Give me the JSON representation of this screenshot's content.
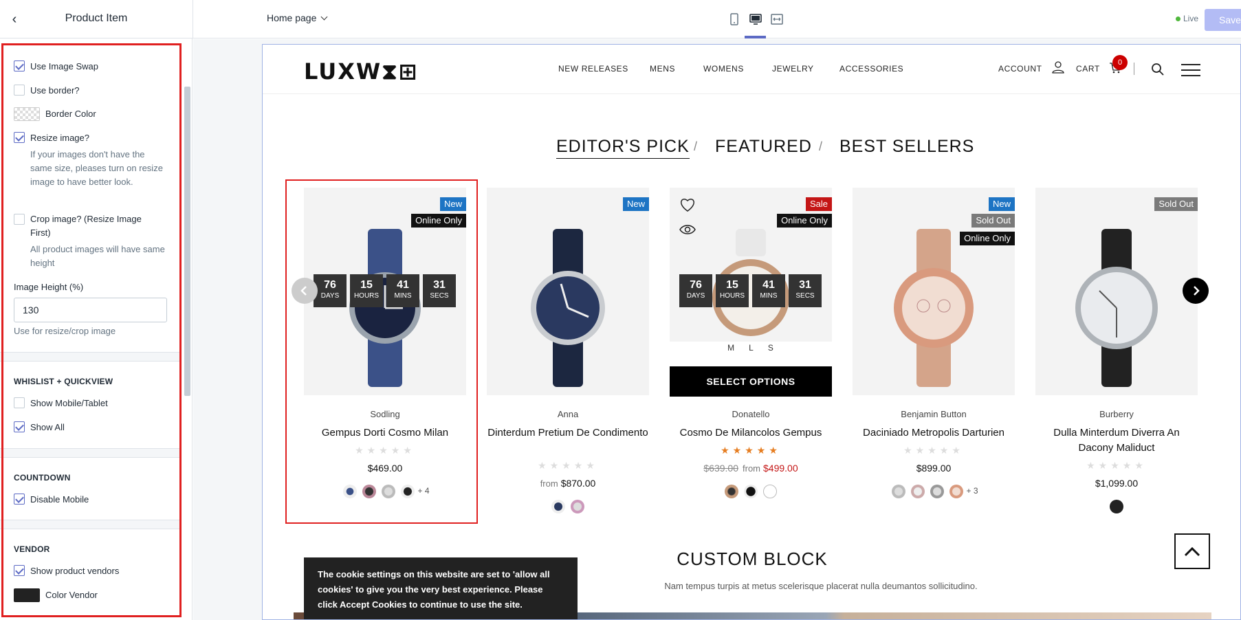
{
  "editor": {
    "panel_title": "Product Item",
    "page_selector": "Home page",
    "live_label": "Live",
    "save_label": "Save"
  },
  "sidebar": {
    "use_image_swap": {
      "label": "Use Image Swap",
      "checked": true
    },
    "use_border": {
      "label": "Use border?",
      "checked": false
    },
    "border_color": {
      "label": "Border Color"
    },
    "resize_image": {
      "label": "Resize image?",
      "checked": true,
      "help": "If your images don't have the same size, pleases turn on resize image to have better look."
    },
    "crop_image": {
      "label": "Crop image? (Resize Image First)",
      "checked": false,
      "help": "All product images will have same height"
    },
    "image_height": {
      "label": "Image Height (%)",
      "value": "130",
      "help": "Use for resize/crop image"
    },
    "wishlist_section": {
      "heading": "WHISLIST + QUICKVIEW",
      "show_mobile": {
        "label": "Show Mobile/Tablet",
        "checked": false
      },
      "show_all": {
        "label": "Show All",
        "checked": true
      }
    },
    "countdown_section": {
      "heading": "COUNTDOWN",
      "disable_mobile": {
        "label": "Disable Mobile",
        "checked": true
      }
    },
    "vendor_section": {
      "heading": "VENDOR",
      "show_vendors": {
        "label": "Show product vendors",
        "checked": true
      },
      "color_vendor": {
        "label": "Color Vendor",
        "color": "#222222"
      }
    }
  },
  "store": {
    "logo": "LUXW⧗⊞",
    "nav": [
      "NEW RELEASES",
      "MENS",
      "WOMENS",
      "JEWELRY",
      "ACCESSORIES"
    ],
    "account_label": "ACCOUNT",
    "cart_label": "CART",
    "cart_count": "0",
    "tabs": [
      "EDITOR'S PICK",
      "FEATURED",
      "BEST SELLERS"
    ],
    "tab_sep": "/",
    "products": [
      {
        "vendor": "Sodling",
        "name": "Gempus Dorti Cosmo Milan",
        "badges": [
          "New",
          "Online Only"
        ],
        "price": "$469.00",
        "more": "+ 4",
        "rating": 0,
        "countdown": {
          "days": "76",
          "days_label": "DAYS",
          "hours": "15",
          "hours_label": "HOURS",
          "mins": "41",
          "mins_label": "MINS",
          "secs": "31",
          "secs_label": "SECS"
        }
      },
      {
        "vendor": "Anna",
        "name": "Dinterdum Pretium De Condimento",
        "badges": [
          "New"
        ],
        "from": "from",
        "price": "$870.00",
        "rating": 0
      },
      {
        "vendor": "Donatello",
        "name": "Cosmo De Milancolos Gempus",
        "badges": [
          "Sale",
          "Online Only"
        ],
        "old_price": "$639.00",
        "from": "from",
        "price": "$499.00",
        "rating": 5,
        "sizes": [
          "M",
          "L",
          "S"
        ],
        "select_label": "SELECT OPTIONS",
        "countdown": {
          "days": "76",
          "days_label": "DAYS",
          "hours": "15",
          "hours_label": "HOURS",
          "mins": "41",
          "mins_label": "MINS",
          "secs": "31",
          "secs_label": "SECS"
        }
      },
      {
        "vendor": "Benjamin Button",
        "name": "Daciniado Metropolis Darturien",
        "badges": [
          "New",
          "Sold Out",
          "Online Only"
        ],
        "price": "$899.00",
        "more": "+ 3",
        "rating": 0
      },
      {
        "vendor": "Burberry",
        "name": "Dulla Minterdum Diverra An Dacony Maliduct",
        "badges": [
          "Sold Out"
        ],
        "price": "$1,099.00",
        "rating": 0
      }
    ],
    "stars_text": "★★★★★",
    "custom_block": {
      "title": "CUSTOM BLOCK",
      "subtitle": "Nam tempus turpis at metus scelerisque placerat nulla deumantos sollicitudino."
    },
    "cookie_text": "The cookie settings on this website are set to 'allow all cookies' to give you the very best experience. Please click Accept Cookies to continue to use the site."
  }
}
